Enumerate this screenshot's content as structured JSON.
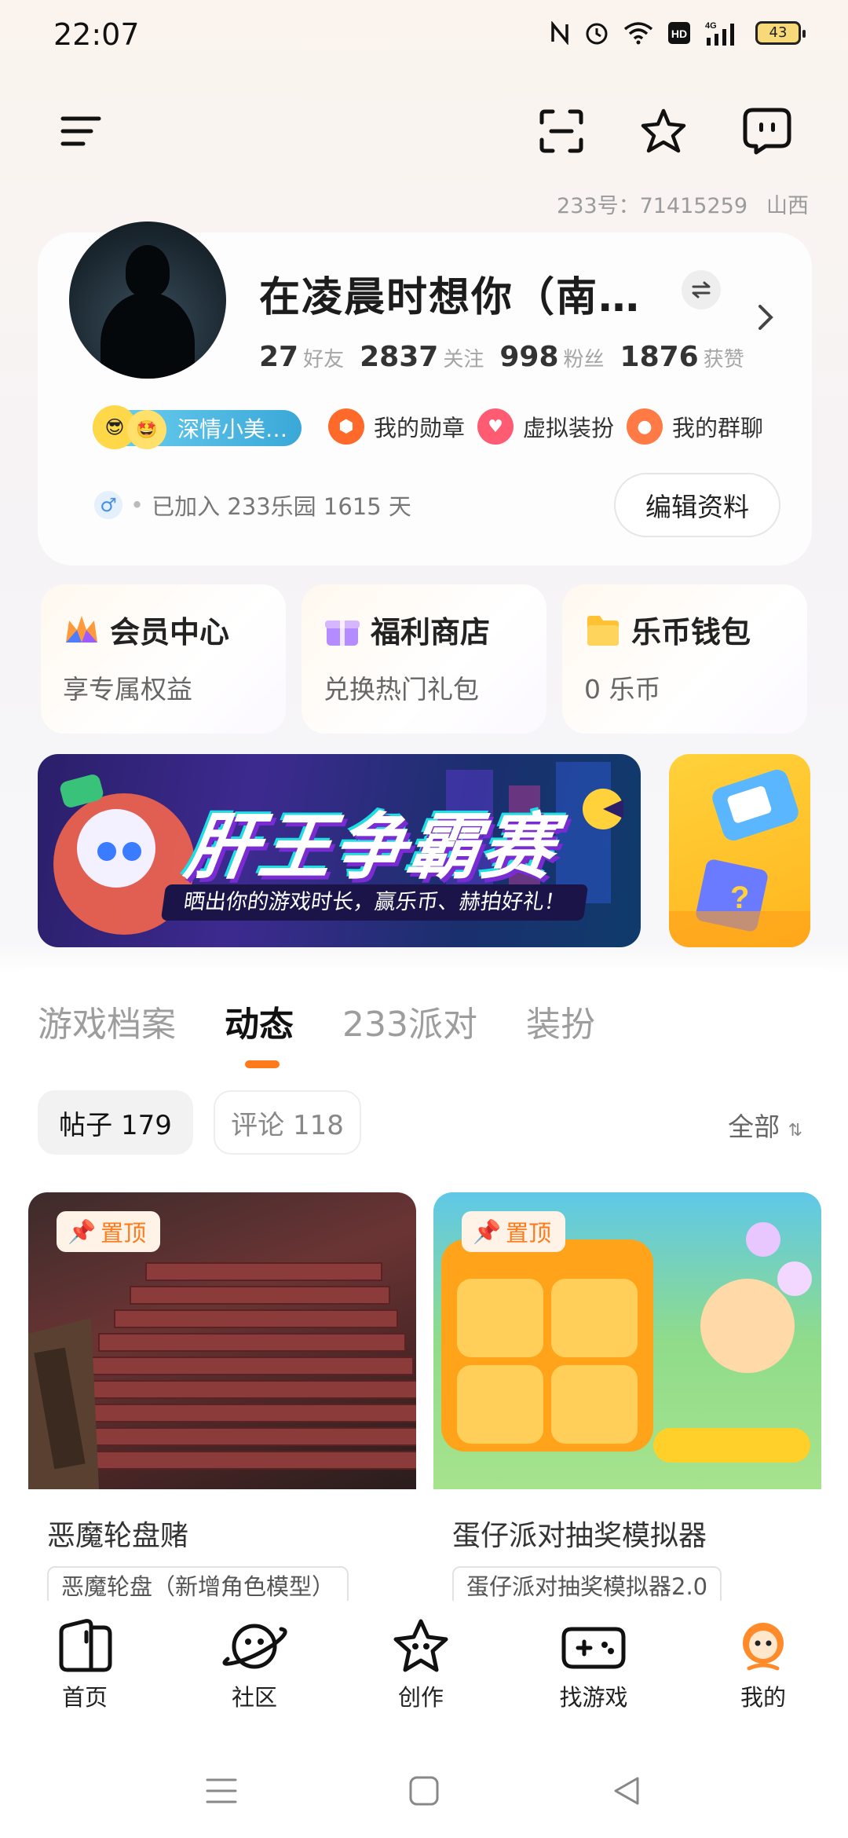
{
  "status_bar": {
    "time": "22:07",
    "battery": "43",
    "icons": [
      "nfc-icon",
      "alarm-icon",
      "wifi-icon",
      "hd-icon",
      "signal-4g-icon",
      "battery-icon"
    ]
  },
  "top_bar": {
    "icons": [
      "menu-icon",
      "scan-icon",
      "star-icon",
      "message-icon"
    ]
  },
  "account": {
    "id_label": "233号：71415259",
    "region": "山西"
  },
  "profile": {
    "username": "在凌晨时想你（南…",
    "stats": [
      {
        "num": "27",
        "label": "好友"
      },
      {
        "num": "2837",
        "label": "关注"
      },
      {
        "num": "998",
        "label": "粉丝"
      },
      {
        "num": "1876",
        "label": "获赞"
      }
    ],
    "title_badge": "深情小美…",
    "links": {
      "medal": "我的勋章",
      "outfit": "虚拟装扮",
      "groups": "我的群聊"
    },
    "join_text": "已加入 233乐园 1615 天",
    "edit_button": "编辑资料"
  },
  "features": [
    {
      "title": "会员中心",
      "sub": "享专属权益"
    },
    {
      "title": "福利商店",
      "sub": "兑换热门礼包"
    },
    {
      "title": "乐币钱包",
      "sub": "0 乐币"
    }
  ],
  "banner": {
    "title": "肝王争霸赛",
    "subtitle": "晒出你的游戏时长，赢乐币、赫拍好礼！"
  },
  "tabs": [
    "游戏档案",
    "动态",
    "233派对",
    "装扮"
  ],
  "filters": {
    "posts": "帖子 179",
    "comments": "评论 118",
    "sort": "全部"
  },
  "posts": [
    {
      "pin": "置顶",
      "title": "恶魔轮盘赌",
      "tag": "恶魔轮盘（新增角色模型）"
    },
    {
      "pin": "置顶",
      "title": "蛋仔派对抽奖模拟器",
      "tag": "蛋仔派对抽奖模拟器2.0"
    }
  ],
  "bottom_nav": [
    {
      "label": "首页",
      "icon": "home-icon"
    },
    {
      "label": "社区",
      "icon": "planet-icon"
    },
    {
      "label": "创作",
      "icon": "create-star-icon"
    },
    {
      "label": "找游戏",
      "icon": "gamepad-icon"
    },
    {
      "label": "我的",
      "icon": "profile-icon"
    }
  ],
  "colors": {
    "accent": "#ff7a1a",
    "badge_blue": "#3aa8d8"
  }
}
